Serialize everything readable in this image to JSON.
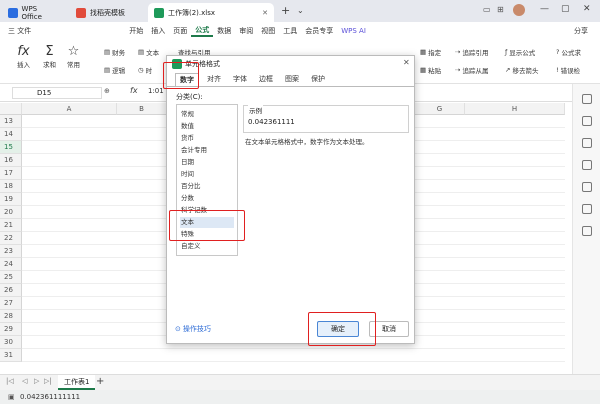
{
  "tabs": [
    {
      "label": "WPS Office"
    },
    {
      "label": "找稻壳模板"
    },
    {
      "label": "工作簿(2).xlsx"
    }
  ],
  "menu": {
    "file": "三 文件",
    "items": [
      "开始",
      "插入",
      "页面",
      "公式",
      "数据",
      "审阅",
      "视图",
      "工具",
      "会员专享"
    ],
    "wps_ai": "WPS AI",
    "share": "分享"
  },
  "ribbon": {
    "insert_func": "插入",
    "sum": "求和",
    "common": "常用",
    "finance": "财务",
    "logic": "逻辑",
    "text": "文本",
    "time": "时",
    "lookup": "查找与引用",
    "specify": "指定",
    "paste": "粘贴",
    "trace_ref": "追踪引用",
    "trace_dep": "追踪从属",
    "show_formula": "显示公式",
    "remove_arrows": "移去箭头",
    "formula_check": "公式求",
    "error_check": "错误检"
  },
  "formula_bar": {
    "cell_ref": "D15",
    "fx": "fx",
    "content": "1:01"
  },
  "grid": {
    "columns": [
      "A",
      "B",
      "C",
      "D",
      "E",
      "F",
      "G",
      "H"
    ],
    "rows": [
      "13",
      "14",
      "15",
      "16",
      "17",
      "18",
      "19",
      "20",
      "21",
      "22",
      "23",
      "24",
      "25",
      "26",
      "27",
      "28",
      "29",
      "30",
      "31",
      "32",
      "33",
      "34",
      "35",
      "36"
    ]
  },
  "dialog": {
    "title": "单元格格式",
    "tabs": [
      "数字",
      "对齐",
      "字体",
      "边框",
      "图案",
      "保护"
    ],
    "category_label": "分类(C):",
    "categories": [
      "常规",
      "数值",
      "货币",
      "会计专用",
      "日期",
      "时间",
      "百分比",
      "分数",
      "科学记数",
      "文本",
      "特殊",
      "自定义"
    ],
    "sample_label": "示例",
    "sample_value": "0.042361111",
    "description": "在文本单元格格式中，数字作为文本处理。",
    "tips_link": "操作技巧",
    "ok": "确定",
    "cancel": "取消"
  },
  "sheet": {
    "name": "工作表1",
    "add": "+"
  },
  "status": {
    "value": "0.042361111111"
  }
}
